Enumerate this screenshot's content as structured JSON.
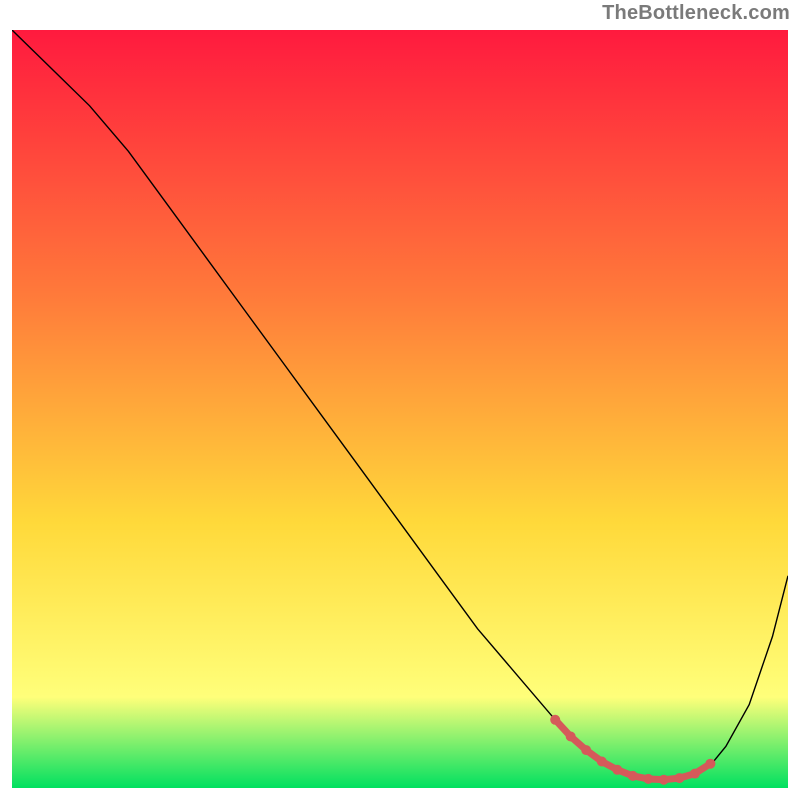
{
  "attribution": "TheBottleneck.com",
  "chart_data": {
    "type": "line",
    "title": "",
    "xlabel": "",
    "ylabel": "",
    "xlim": [
      0,
      100
    ],
    "ylim": [
      0,
      100
    ],
    "grid": false,
    "legend": false,
    "background_gradient": {
      "top_color": "#ff1a3e",
      "mid_color_1": "#ff7a3a",
      "mid_color_2": "#ffd93a",
      "mid_color_3": "#ffff7a",
      "bottom_color": "#00e060",
      "stops": [
        0,
        35,
        65,
        88,
        100
      ]
    },
    "series": [
      {
        "name": "bottleneck-curve",
        "color": "#000000",
        "width": 1.4,
        "x": [
          0,
          3,
          6,
          10,
          15,
          20,
          25,
          30,
          35,
          40,
          45,
          50,
          55,
          60,
          65,
          70,
          73,
          76,
          79,
          82,
          85,
          88,
          90,
          92,
          95,
          98,
          100
        ],
        "y": [
          100,
          97,
          94,
          90,
          84,
          77,
          70,
          63,
          56,
          49,
          42,
          35,
          28,
          21,
          15,
          9,
          6,
          3.5,
          2,
          1.2,
          1.0,
          1.5,
          3,
          5.5,
          11,
          20,
          28
        ]
      },
      {
        "name": "bottleneck-highlight",
        "color": "#d55a5a",
        "width": 7,
        "linecap": "round",
        "x": [
          70,
          72,
          74,
          76,
          78,
          80,
          82,
          84,
          86,
          88,
          90
        ],
        "y": [
          9,
          6.8,
          5,
          3.5,
          2.4,
          1.6,
          1.2,
          1.1,
          1.3,
          1.9,
          3.2
        ]
      }
    ]
  }
}
